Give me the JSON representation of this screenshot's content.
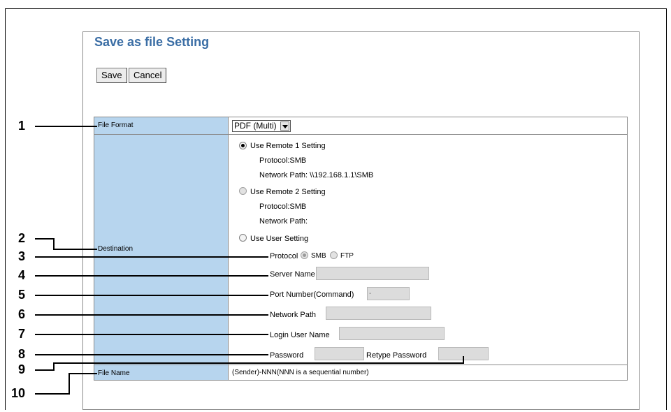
{
  "page": {
    "title": "Save as file Setting"
  },
  "toolbar": {
    "save_label": "Save",
    "cancel_label": "Cancel"
  },
  "rows": {
    "file_format": {
      "label": "File Format",
      "selected": "PDF (Multi)"
    },
    "destination": {
      "label": "Destination",
      "remote1": {
        "label": "Use Remote 1 Setting",
        "protocol": "Protocol:SMB",
        "path": "Network Path: \\\\192.168.1.1\\SMB"
      },
      "remote2": {
        "label": "Use Remote 2 Setting",
        "protocol": "Protocol:SMB",
        "path": "Network Path:"
      },
      "user": {
        "label": "Use User Setting"
      },
      "protocol_label": "Protocol",
      "protocol_smb": "SMB",
      "protocol_ftp": "FTP",
      "server_name": "Server Name",
      "port_number": "Port Number(Command)",
      "port_value": "-",
      "network_path": "Network Path",
      "login_user": "Login User Name",
      "password": "Password",
      "retype_password": "Retype Password"
    },
    "file_name": {
      "label": "File Name",
      "value": "(Sender)-NNN(NNN is a sequential number)"
    }
  },
  "callouts": [
    "1",
    "2",
    "3",
    "4",
    "5",
    "6",
    "7",
    "8",
    "9",
    "10"
  ]
}
